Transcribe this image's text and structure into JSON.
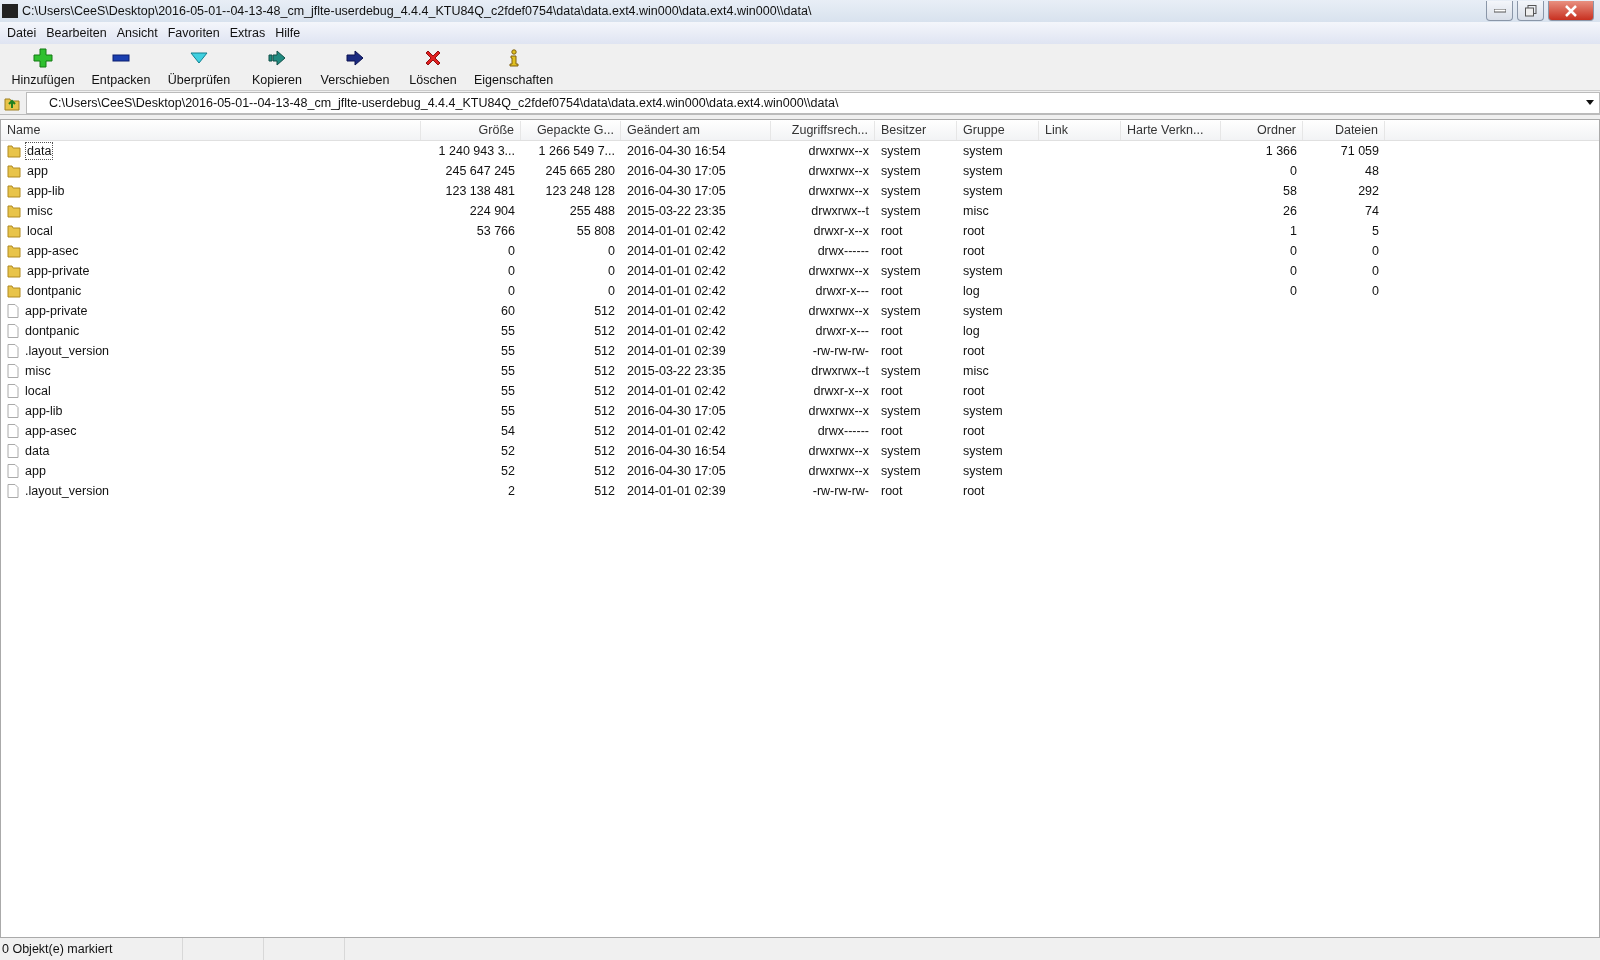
{
  "window": {
    "title": "C:\\Users\\CeeS\\Desktop\\2016-05-01--04-13-48_cm_jflte-userdebug_4.4.4_KTU84Q_c2fdef0754\\data\\data.ext4.win000\\data.ext4.win000\\\\data\\"
  },
  "menu": [
    "Datei",
    "Bearbeiten",
    "Ansicht",
    "Favoriten",
    "Extras",
    "Hilfe"
  ],
  "toolbar": [
    "Hinzufügen",
    "Entpacken",
    "Überprüfen",
    "Kopieren",
    "Verschieben",
    "Löschen",
    "Eigenschaften"
  ],
  "address": {
    "value": "C:\\Users\\CeeS\\Desktop\\2016-05-01--04-13-48_cm_jflte-userdebug_4.4.4_KTU84Q_c2fdef0754\\data\\data.ext4.win000\\data.ext4.win000\\\\data\\"
  },
  "table": {
    "columns": [
      "Name",
      "Größe",
      "Gepackte G...",
      "Geändert am",
      "Zugriffsrech...",
      "Besitzer",
      "Gruppe",
      "Link",
      "Harte Verkn...",
      "Ordner",
      "Dateien"
    ],
    "rows": [
      {
        "kind": "folder",
        "focused": true,
        "name": "data",
        "size": "1 240 943 3...",
        "packed": "1 266 549 7...",
        "modified": "2016-04-30 16:54",
        "attributes": "drwxrwx--x",
        "owner": "system",
        "group": "system",
        "folders": "1 366",
        "files": "71 059"
      },
      {
        "kind": "folder",
        "focused": false,
        "name": "app",
        "size": "245 647 245",
        "packed": "245 665 280",
        "modified": "2016-04-30 17:05",
        "attributes": "drwxrwx--x",
        "owner": "system",
        "group": "system",
        "folders": "0",
        "files": "48"
      },
      {
        "kind": "folder",
        "focused": false,
        "name": "app-lib",
        "size": "123 138 481",
        "packed": "123 248 128",
        "modified": "2016-04-30 17:05",
        "attributes": "drwxrwx--x",
        "owner": "system",
        "group": "system",
        "folders": "58",
        "files": "292"
      },
      {
        "kind": "folder",
        "focused": false,
        "name": "misc",
        "size": "224 904",
        "packed": "255 488",
        "modified": "2015-03-22 23:35",
        "attributes": "drwxrwx--t",
        "owner": "system",
        "group": "misc",
        "folders": "26",
        "files": "74"
      },
      {
        "kind": "folder",
        "focused": false,
        "name": "local",
        "size": "53 766",
        "packed": "55 808",
        "modified": "2014-01-01 02:42",
        "attributes": "drwxr-x--x",
        "owner": "root",
        "group": "root",
        "folders": "1",
        "files": "5"
      },
      {
        "kind": "folder",
        "focused": false,
        "name": "app-asec",
        "size": "0",
        "packed": "0",
        "modified": "2014-01-01 02:42",
        "attributes": "drwx------",
        "owner": "root",
        "group": "root",
        "folders": "0",
        "files": "0"
      },
      {
        "kind": "folder",
        "focused": false,
        "name": "app-private",
        "size": "0",
        "packed": "0",
        "modified": "2014-01-01 02:42",
        "attributes": "drwxrwx--x",
        "owner": "system",
        "group": "system",
        "folders": "0",
        "files": "0"
      },
      {
        "kind": "folder",
        "focused": false,
        "name": "dontpanic",
        "size": "0",
        "packed": "0",
        "modified": "2014-01-01 02:42",
        "attributes": "drwxr-x---",
        "owner": "root",
        "group": "log",
        "folders": "0",
        "files": "0"
      },
      {
        "kind": "file",
        "focused": false,
        "name": "app-private",
        "size": "60",
        "packed": "512",
        "modified": "2014-01-01 02:42",
        "attributes": "drwxrwx--x",
        "owner": "system",
        "group": "system"
      },
      {
        "kind": "file",
        "focused": false,
        "name": "dontpanic",
        "size": "55",
        "packed": "512",
        "modified": "2014-01-01 02:42",
        "attributes": "drwxr-x---",
        "owner": "root",
        "group": "log"
      },
      {
        "kind": "file",
        "focused": false,
        "name": ".layout_version",
        "size": "55",
        "packed": "512",
        "modified": "2014-01-01 02:39",
        "attributes": "-rw-rw-rw-",
        "owner": "root",
        "group": "root"
      },
      {
        "kind": "file",
        "focused": false,
        "name": "misc",
        "size": "55",
        "packed": "512",
        "modified": "2015-03-22 23:35",
        "attributes": "drwxrwx--t",
        "owner": "system",
        "group": "misc"
      },
      {
        "kind": "file",
        "focused": false,
        "name": "local",
        "size": "55",
        "packed": "512",
        "modified": "2014-01-01 02:42",
        "attributes": "drwxr-x--x",
        "owner": "root",
        "group": "root"
      },
      {
        "kind": "file",
        "focused": false,
        "name": "app-lib",
        "size": "55",
        "packed": "512",
        "modified": "2016-04-30 17:05",
        "attributes": "drwxrwx--x",
        "owner": "system",
        "group": "system"
      },
      {
        "kind": "file",
        "focused": false,
        "name": "app-asec",
        "size": "54",
        "packed": "512",
        "modified": "2014-01-01 02:42",
        "attributes": "drwx------",
        "owner": "root",
        "group": "root"
      },
      {
        "kind": "file",
        "focused": false,
        "name": "data",
        "size": "52",
        "packed": "512",
        "modified": "2016-04-30 16:54",
        "attributes": "drwxrwx--x",
        "owner": "system",
        "group": "system"
      },
      {
        "kind": "file",
        "focused": false,
        "name": "app",
        "size": "52",
        "packed": "512",
        "modified": "2016-04-30 17:05",
        "attributes": "drwxrwx--x",
        "owner": "system",
        "group": "system"
      },
      {
        "kind": "file",
        "focused": false,
        "name": ".layout_version",
        "size": "2",
        "packed": "512",
        "modified": "2014-01-01 02:39",
        "attributes": "-rw-rw-rw-",
        "owner": "root",
        "group": "root"
      }
    ]
  },
  "status_bar": {
    "text": "0 Objekt(e) markiert"
  }
}
